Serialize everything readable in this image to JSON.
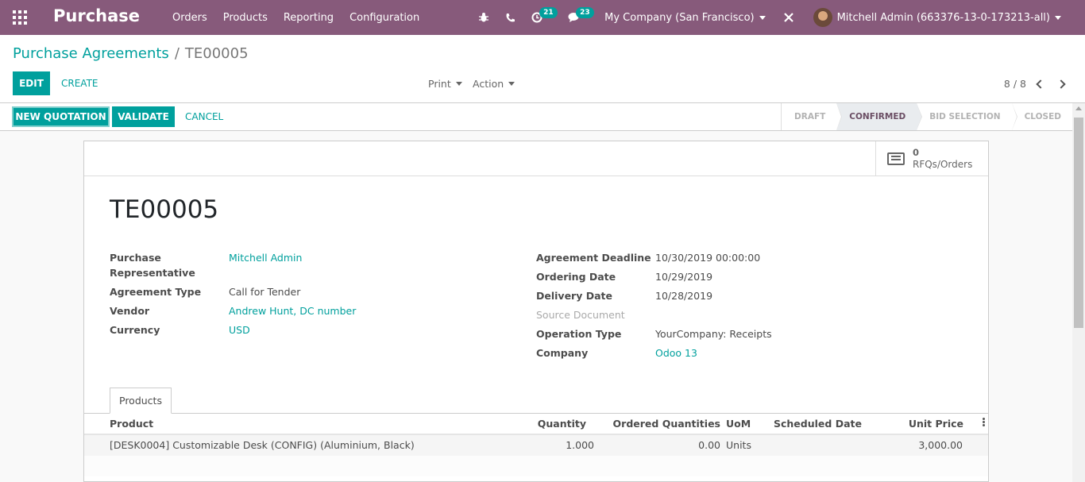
{
  "navbar": {
    "brand": "Purchase",
    "menu": [
      "Orders",
      "Products",
      "Reporting",
      "Configuration"
    ],
    "activity_count": "21",
    "messages_count": "23",
    "company": "My Company (San Francisco)",
    "user": "Mitchell Admin (663376-13-0-173213-all)"
  },
  "breadcrumb": {
    "parent": "Purchase Agreements",
    "separator": "/",
    "current": "TE00005"
  },
  "toolbar": {
    "edit": "EDIT",
    "create": "CREATE",
    "print": "Print",
    "action": "Action",
    "pager": "8 / 8"
  },
  "statusbar": {
    "new_quotation": "NEW QUOTATION",
    "validate": "VALIDATE",
    "cancel": "CANCEL",
    "stages": [
      "DRAFT",
      "CONFIRMED",
      "BID SELECTION",
      "CLOSED"
    ],
    "current_stage": "CONFIRMED"
  },
  "smart_button": {
    "value": "0",
    "label": "RFQs/Orders"
  },
  "record": {
    "name": "TE00005",
    "left_fields": {
      "purchase_representative_label_1": "Purchase",
      "purchase_representative_label_2": "Representative",
      "purchase_representative": "Mitchell Admin",
      "agreement_type_label": "Agreement Type",
      "agreement_type": "Call for Tender",
      "vendor_label": "Vendor",
      "vendor": "Andrew Hunt, DC number",
      "currency_label": "Currency",
      "currency": "USD"
    },
    "right_fields": {
      "agreement_deadline_label": "Agreement Deadline",
      "agreement_deadline": "10/30/2019 00:00:00",
      "ordering_date_label": "Ordering Date",
      "ordering_date": "10/29/2019",
      "delivery_date_label": "Delivery Date",
      "delivery_date": "10/28/2019",
      "source_document_label": "Source Document",
      "operation_type_label": "Operation Type",
      "operation_type": "YourCompany: Receipts",
      "company_label": "Company",
      "company": "Odoo 13"
    }
  },
  "tabs": [
    "Products"
  ],
  "lines_table": {
    "headers": [
      "Product",
      "Quantity",
      "Ordered Quantities",
      "UoM",
      "Scheduled Date",
      "Unit Price"
    ],
    "rows": [
      {
        "product": "[DESK0004] Customizable Desk (CONFIG) (Aluminium, Black)",
        "quantity": "1.000",
        "ordered": "0.00",
        "uom": "Units",
        "scheduled_date": "",
        "unit_price": "3,000.00"
      }
    ]
  },
  "colors": {
    "brand": "#875a7b",
    "accent": "#00a09d"
  }
}
